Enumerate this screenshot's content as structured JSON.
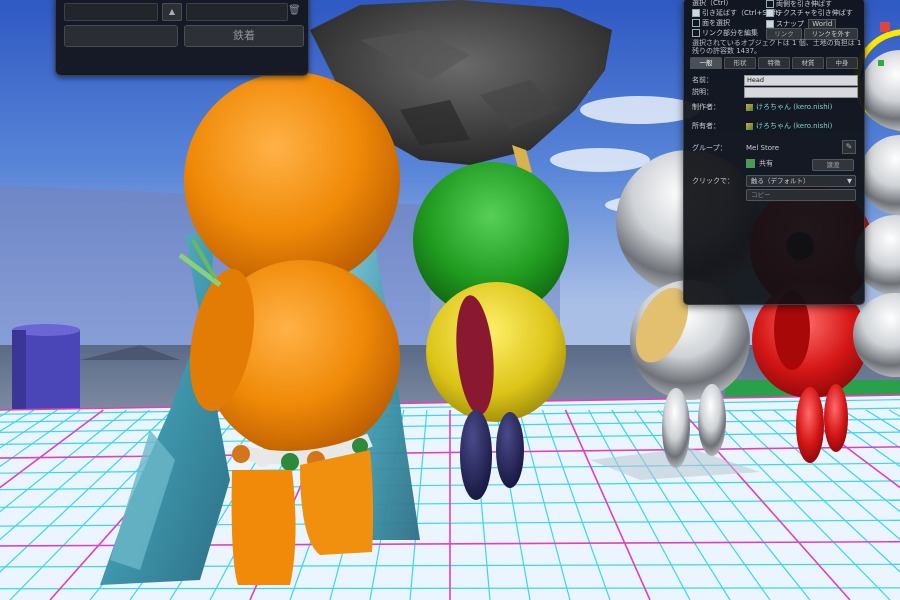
{
  "colors": {
    "sky_top": "#3a63c6",
    "sky_bottom": "#b9c9e8",
    "grid_fill": "#eaf4ff",
    "grid_cyan": "#35d6f0",
    "grid_magenta": "#e040c0",
    "grid_blue": "#2b34d0",
    "avatar_orange": "#f08c0a",
    "avatar_green": "#2a9a2a",
    "avatar_yellow": "#e0c81a",
    "avatar_red": "#d81818",
    "avatar_silver": "#c8c8c8",
    "avatar_navy": "#1a1a4a",
    "cape_teal": "#49a7b8"
  },
  "top_left_panel": {
    "button_label": "鉄着"
  },
  "edit_panel": {
    "header_partial": "選択（Ctrl）",
    "opt_stretch_both": "両側を引き伸ばす",
    "opt_stretch_texture": "テクスチャを引き伸ばす",
    "opt_stretch_texture_checked": true,
    "opt_snap": "スナップ",
    "opt_snap_value": "World",
    "opt_snap_checked": true,
    "opt_stretch_both_checked": false,
    "opt_pull_label": "引き延ばす（Ctrl+Shift）",
    "opt_pull_checked": true,
    "opt_select_face": "面を選択",
    "opt_edit_linked": "リンク部分を編集",
    "link_button": "リンク",
    "unlink_button": "リンクを外す",
    "selection_info_line1": "選択されているオブジェクトは 1 個、土地の負担は 1",
    "selection_info_line2": "残りの許容数 1437。",
    "tabs": [
      "一般",
      "形状",
      "特徴",
      "材質",
      "中身"
    ],
    "active_tab": "一般",
    "name_label": "名前：",
    "name_value": "Head",
    "desc_label": "説明：",
    "desc_value": "",
    "creator_label": "制作者：",
    "creator_value": "けろちゃん (kero.nishi)",
    "owner_label": "所有者：",
    "owner_value": "けろちゃん (kero.nishi)",
    "group_label": "グループ：",
    "group_value": "Mel Store",
    "share_label": "共有",
    "deed_button": "譲渡",
    "click_label": "クリックで：",
    "click_value": "触る（デフォルト）",
    "copy_label": "コピー"
  },
  "scene": {
    "description_hidden": ""
  }
}
